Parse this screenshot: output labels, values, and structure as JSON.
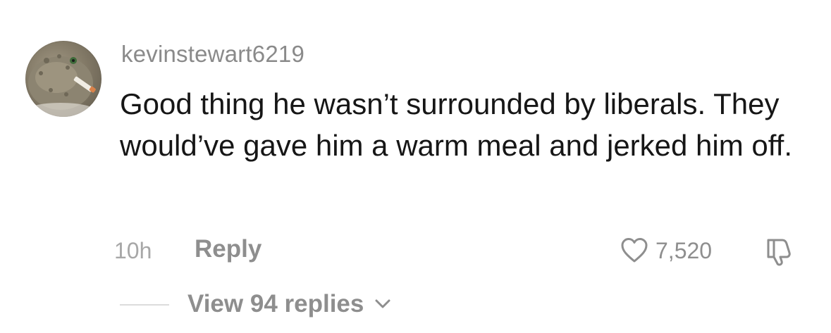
{
  "comment": {
    "username": "kevinstewart6219",
    "text": "Good thing he wasn’t surrounded by liberals. They would’ve gave him a warm meal and jerked him off.",
    "time": "10h",
    "reply_label": "Reply",
    "like_count": "7,520",
    "view_replies_label": "View 94 replies"
  },
  "icons": {
    "avatar": "pufferfish-with-cigarette-avatar",
    "like": "heart-outline-icon",
    "dislike": "thumbs-down-icon",
    "expand": "chevron-down-icon"
  },
  "colors": {
    "text": "#161616",
    "muted": "#8e8e8e",
    "username": "#8a8a8a",
    "background": "#ffffff"
  }
}
